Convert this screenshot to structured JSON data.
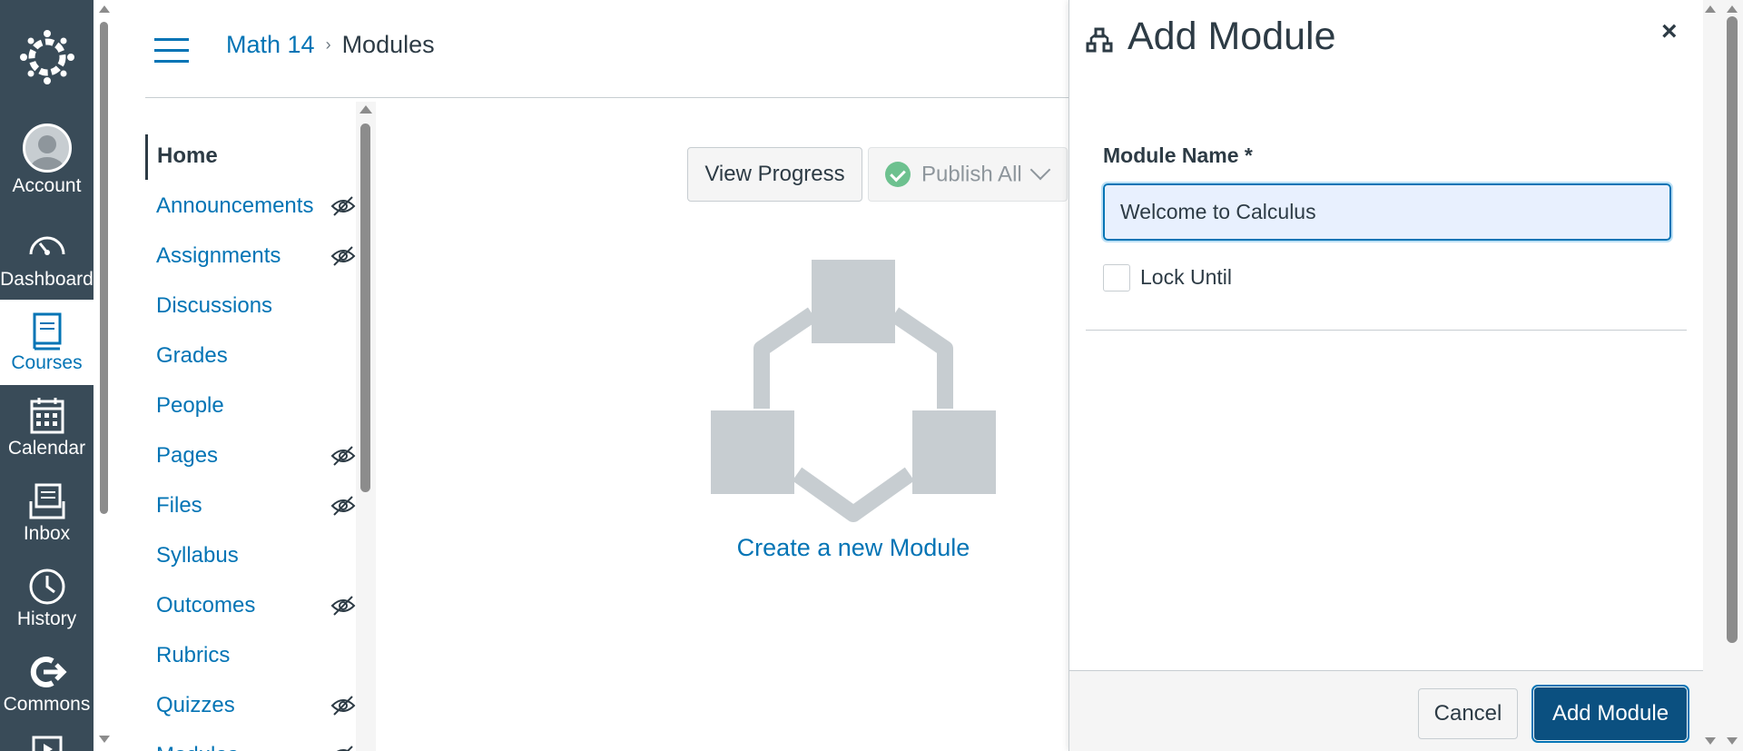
{
  "global_nav": {
    "logo_icon": "canvas-logo-icon",
    "items": [
      {
        "label": "Account",
        "icon": "avatar"
      },
      {
        "label": "Dashboard",
        "icon": "dashboard-icon"
      },
      {
        "label": "Courses",
        "icon": "courses-icon",
        "active": true
      },
      {
        "label": "Calendar",
        "icon": "calendar-icon"
      },
      {
        "label": "Inbox",
        "icon": "inbox-icon"
      },
      {
        "label": "History",
        "icon": "history-icon"
      },
      {
        "label": "Commons",
        "icon": "commons-icon"
      }
    ]
  },
  "header": {
    "breadcrumb": {
      "course": "Math 14",
      "separator": "›",
      "current": "Modules"
    }
  },
  "course_nav": {
    "items": [
      {
        "label": "Home",
        "active": true,
        "hidden": false
      },
      {
        "label": "Announcements",
        "hidden": true
      },
      {
        "label": "Assignments",
        "hidden": true
      },
      {
        "label": "Discussions",
        "hidden": false
      },
      {
        "label": "Grades",
        "hidden": false
      },
      {
        "label": "People",
        "hidden": false
      },
      {
        "label": "Pages",
        "hidden": true
      },
      {
        "label": "Files",
        "hidden": true
      },
      {
        "label": "Syllabus",
        "hidden": false
      },
      {
        "label": "Outcomes",
        "hidden": true
      },
      {
        "label": "Rubrics",
        "hidden": false
      },
      {
        "label": "Quizzes",
        "hidden": true
      },
      {
        "label": "Modules",
        "hidden": true
      }
    ]
  },
  "main": {
    "view_progress_label": "View Progress",
    "publish_all_label": "Publish All",
    "create_module_link": "Create a new Module"
  },
  "tray": {
    "title": "Add Module",
    "close_label": "×",
    "module_name_label": "Module Name *",
    "module_name_value": "Welcome to Calculus",
    "lock_until_label": "Lock Until",
    "lock_until_checked": false,
    "cancel_label": "Cancel",
    "submit_label": "Add Module"
  },
  "colors": {
    "nav_bg": "#394b58",
    "link": "#0374b5",
    "primary_button": "#0b5080",
    "published_green": "#6dc18f"
  }
}
